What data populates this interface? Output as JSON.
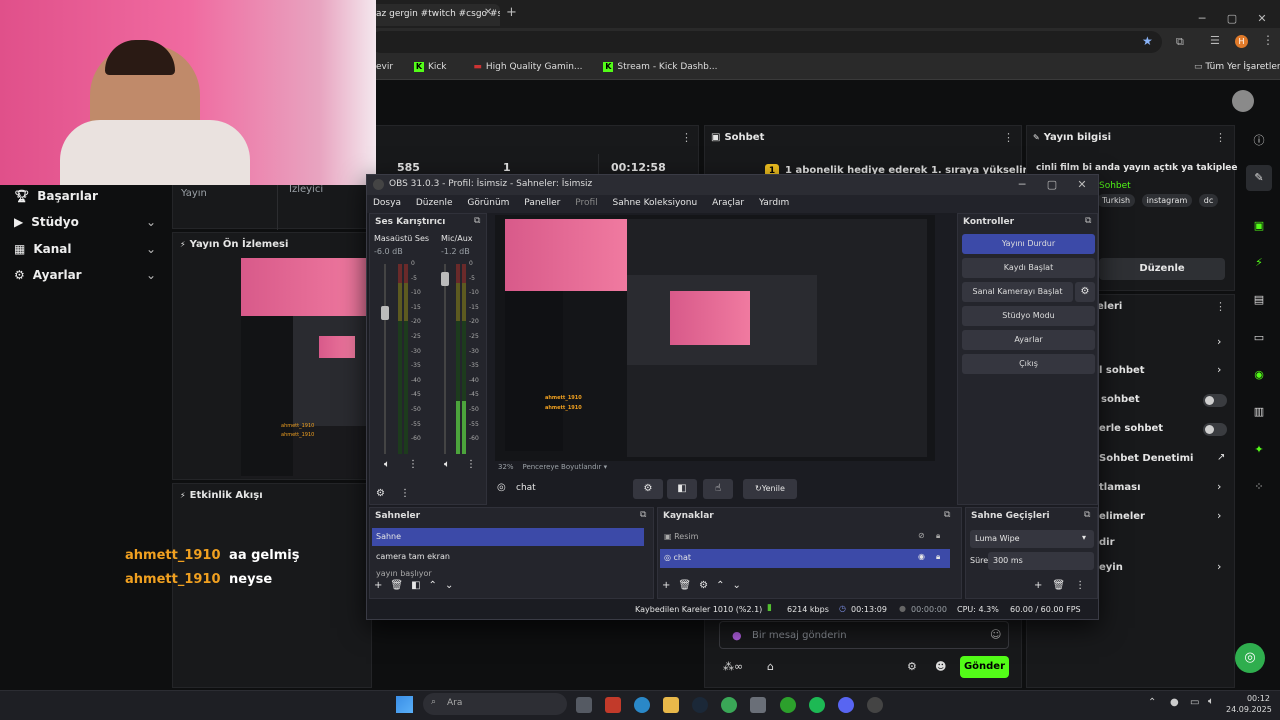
{
  "browser": {
    "tab_title": "az gergin #twitch #csgo #sh",
    "bookmarks": [
      "evir",
      "Kick",
      "High Quality Gamin...",
      "Stream - Kick Dashb..."
    ],
    "all_bookmarks": "Tüm Yer İşaretleri"
  },
  "kick": {
    "stats": [
      {
        "value": "585",
        "label": "Yayın"
      },
      {
        "value": "1",
        "label": "İzleyici"
      },
      {
        "value": "00:12:58",
        "label": ""
      }
    ],
    "nav": [
      {
        "icon": "trophy-icon",
        "label": "Başarılar"
      },
      {
        "icon": "video-icon",
        "label": "Stüdyo"
      },
      {
        "icon": "users-icon",
        "label": "Kanal"
      },
      {
        "icon": "gear-icon",
        "label": "Ayarlar"
      }
    ],
    "preview_title": "Yayın Ön İzlemesi",
    "activity_title": "Etkinlik Akışı",
    "chat_title": "Sohbet",
    "chat_banner": "1 abonelik hediye ederek 1. sıraya yükselin",
    "stream_info_title": "Yayın bilgisi",
    "stream_info_text": "cinli film bi anda yayın açtık ya takiplee",
    "stream_info_tag_green": "Sohbet",
    "tags": [
      "Turkish",
      "instagram",
      "dc"
    ],
    "edit_button": "Düzenle",
    "settings_title": "eleri",
    "settings_items": [
      "l sohbet",
      "sohbet",
      "erle sohbet",
      "Sohbet Denetimi",
      "tlaması",
      "elimeler",
      "dir",
      "eyin"
    ],
    "overlay_chat": [
      {
        "user": "ahmett_1910",
        "msg": "aa gelmiş"
      },
      {
        "user": "ahmett_1910",
        "msg": "neyse"
      }
    ],
    "message_placeholder": "Bir mesaj gönderin",
    "send_button": "Gönder"
  },
  "obs": {
    "title": "OBS 31.0.3 - Profil: İsimsiz - Sahneler: İsimsiz",
    "menu": [
      "Dosya",
      "Düzenle",
      "Görünüm",
      "Paneller",
      "Profil",
      "Sahne Koleksiyonu",
      "Araçlar",
      "Yardım"
    ],
    "audio_title": "Ses Karıştırıcı",
    "channels": [
      {
        "name": "Masaüstü Ses",
        "db": "-6.0 dB"
      },
      {
        "name": "Mic/Aux",
        "db": "-1.2 dB"
      }
    ],
    "scale_ticks": [
      "0",
      "-5",
      "-10",
      "-15",
      "-20",
      "-25",
      "-30",
      "-35",
      "-40",
      "-45",
      "-50",
      "-55",
      "-60"
    ],
    "zoom": "32%",
    "zoom_mode": "Pencereye Boyutlandır",
    "selected_source": "chat",
    "refresh": "Yenile",
    "controls_title": "Kontroller",
    "controls": [
      "Yayını Durdur",
      "Kaydı Başlat",
      "Sanal Kamerayı Başlat",
      "Stüdyo Modu",
      "Ayarlar",
      "Çıkış"
    ],
    "scenes_title": "Sahneler",
    "scenes": [
      "Sahne",
      "camera tam ekran",
      "yayın başlıyor"
    ],
    "sources_title": "Kaynaklar",
    "sources": [
      "Resim",
      "chat"
    ],
    "transitions_title": "Sahne Geçişleri",
    "transition": "Luma Wipe",
    "duration_label": "Süre",
    "duration": "300 ms",
    "status": {
      "dropped": "Kaybedilen Kareler 1010 (%2.1)",
      "bitrate": "6214 kbps",
      "stream_time": "00:13:09",
      "rec_time": "00:00:00",
      "cpu": "CPU: 4.3%",
      "fps": "60.00 / 60.00 FPS"
    }
  },
  "taskbar": {
    "search": "Ara",
    "time": "00:12",
    "date": "24.09.2025"
  },
  "colors": {
    "kick_green": "#53fc18",
    "obs_blue": "#3c4aa8",
    "username_orange": "#f0a020"
  }
}
